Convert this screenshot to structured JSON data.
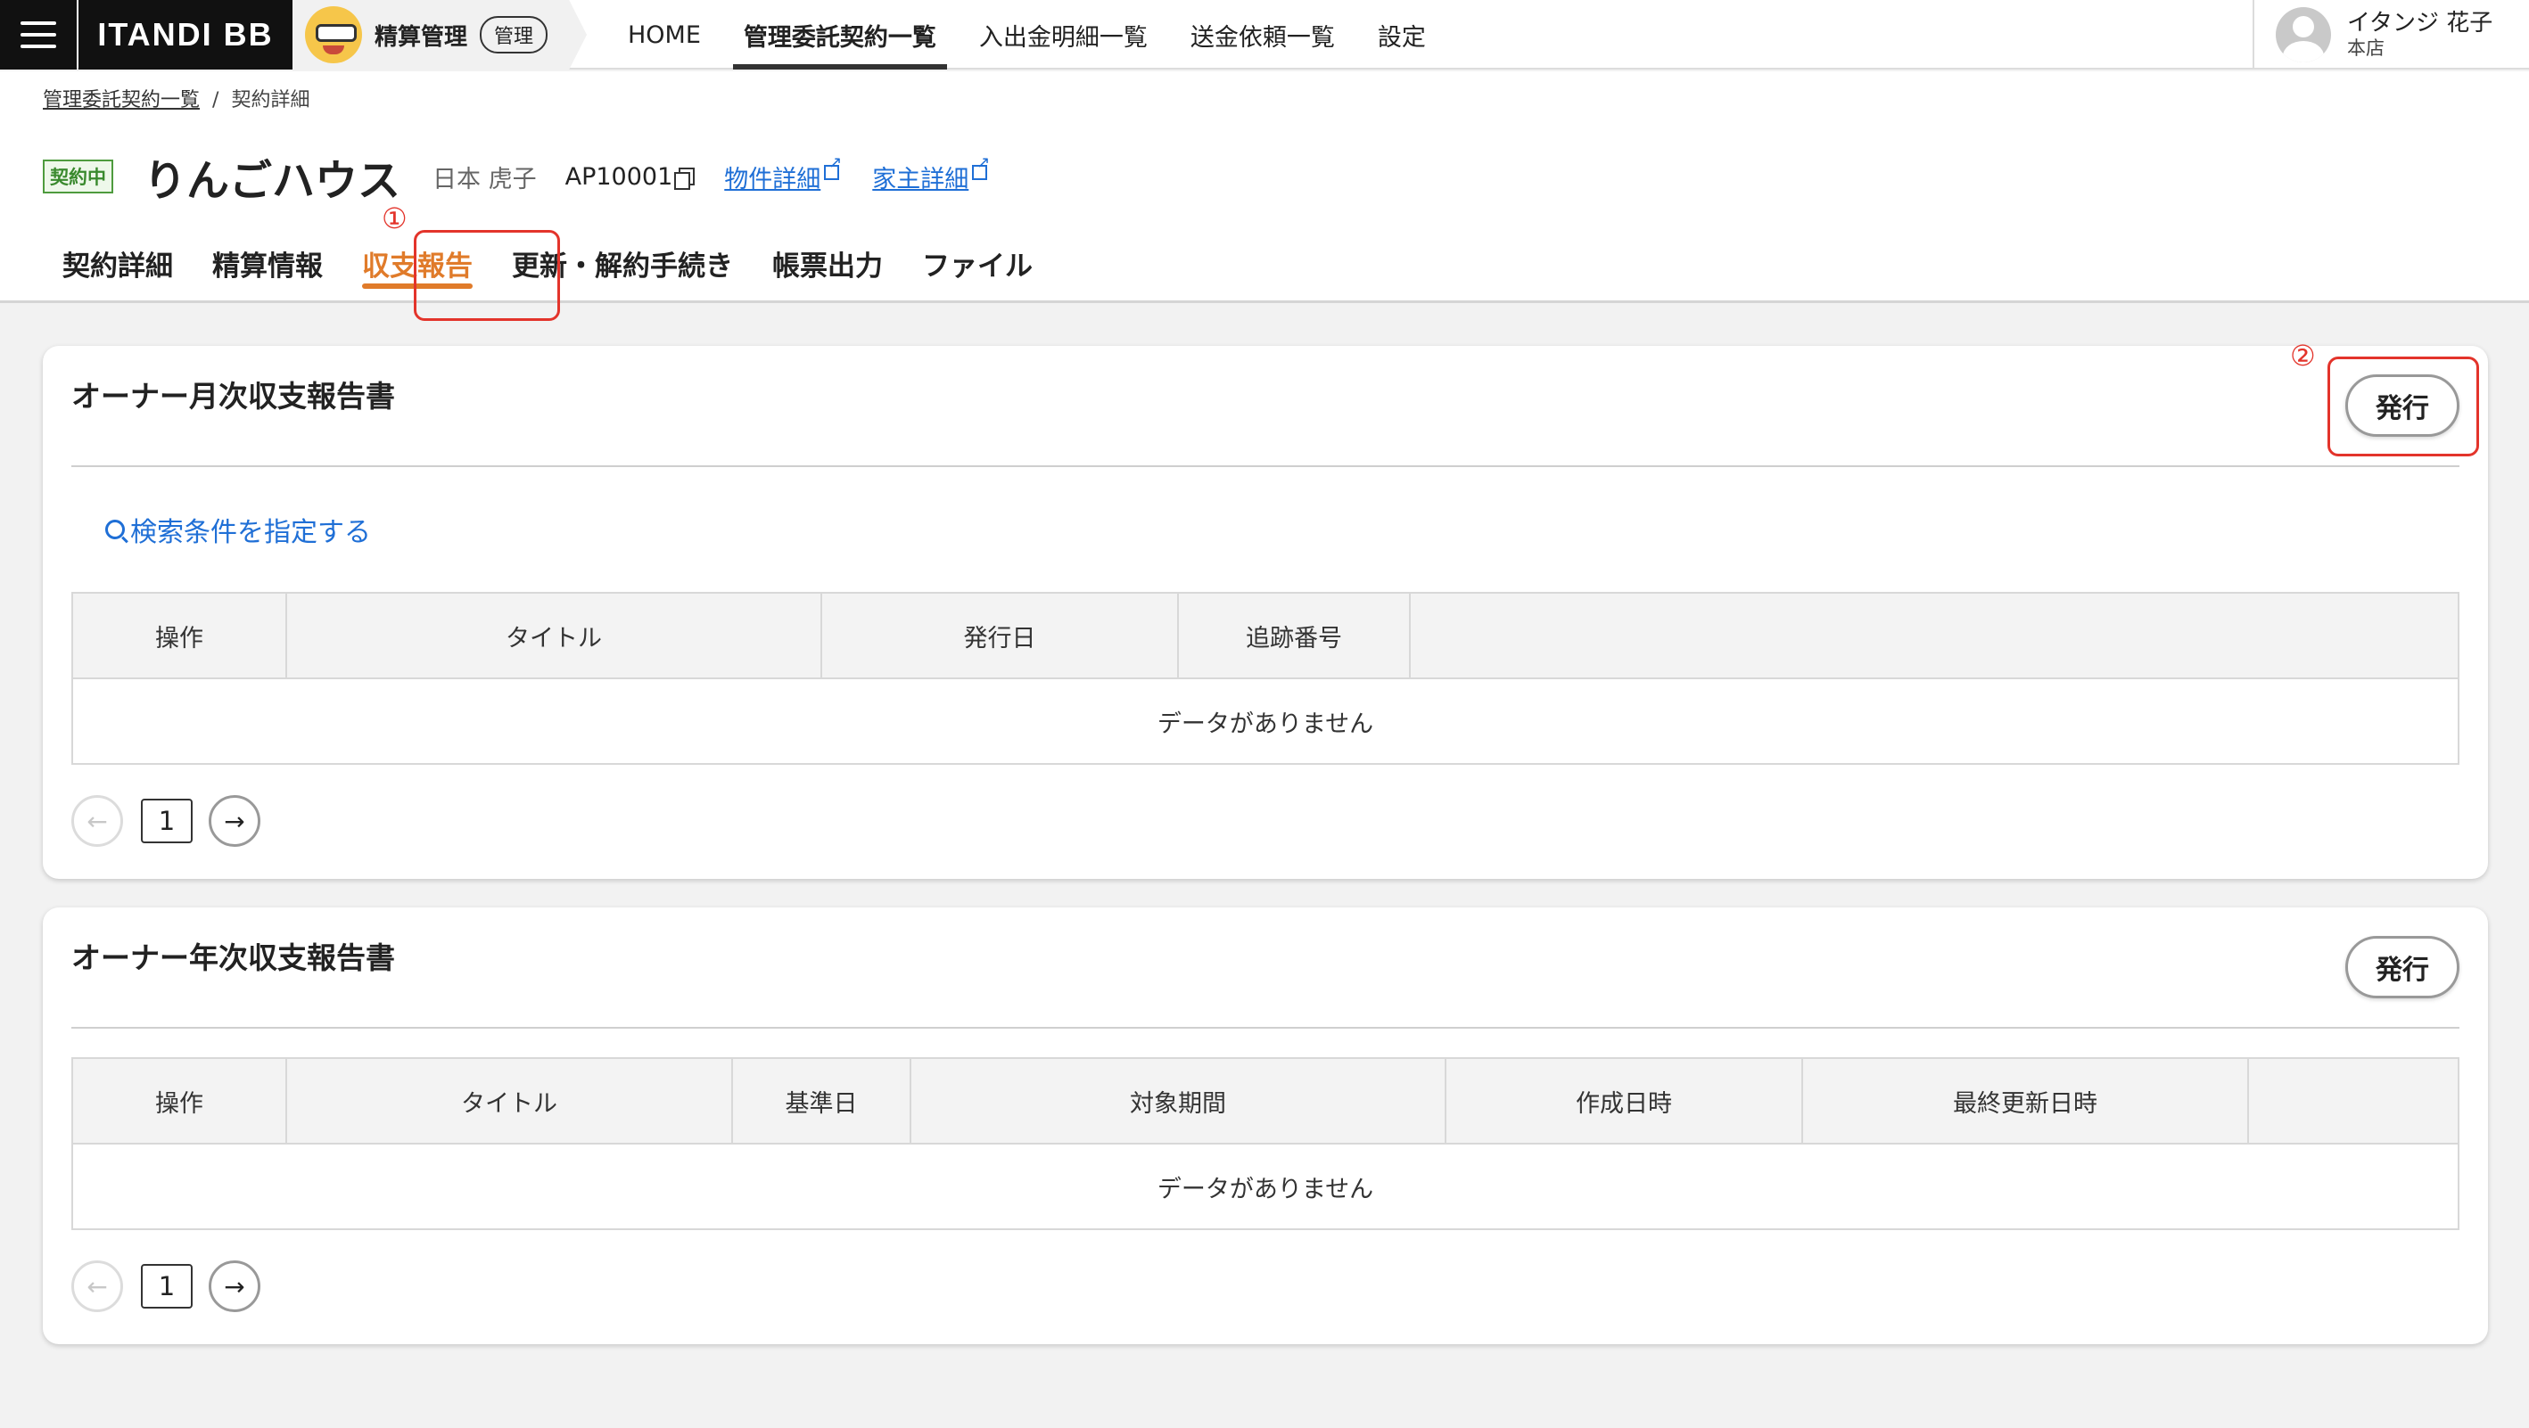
{
  "topbar": {
    "brand": "ITANDI BB",
    "app_name": "精算管理",
    "app_badge": "管理",
    "nav": [
      {
        "label": "HOME"
      },
      {
        "label": "管理委託契約一覧"
      },
      {
        "label": "入出金明細一覧"
      },
      {
        "label": "送金依頼一覧"
      },
      {
        "label": "設定"
      }
    ],
    "active_nav": "管理委託契約一覧",
    "user": {
      "name": "イタンジ 花子",
      "branch": "本店"
    }
  },
  "breadcrumb": {
    "parent": "管理委託契約一覧",
    "separator": "/",
    "current": "契約詳細"
  },
  "header": {
    "status": "契約中",
    "property_name": "りんごハウス",
    "owner_name": "日本 虎子",
    "contract_id": "AP10001",
    "property_link": "物件詳細",
    "landlord_link": "家主詳細"
  },
  "tabs": [
    {
      "label": "契約詳細"
    },
    {
      "label": "精算情報"
    },
    {
      "label": "収支報告"
    },
    {
      "label": "更新・解約手続き"
    },
    {
      "label": "帳票出力"
    },
    {
      "label": "ファイル"
    }
  ],
  "active_tab": "収支報告",
  "annotations": [
    "①",
    "②"
  ],
  "monthly": {
    "title": "オーナー月次収支報告書",
    "issue_label": "発行",
    "search_label": "検索条件を指定する",
    "columns": [
      "操作",
      "タイトル",
      "発行日",
      "追跡番号",
      ""
    ],
    "empty_text": "データがありません",
    "page": "1"
  },
  "yearly": {
    "title": "オーナー年次収支報告書",
    "issue_label": "発行",
    "columns": [
      "操作",
      "タイトル",
      "基準日",
      "対象期間",
      "作成日時",
      "最終更新日時",
      ""
    ],
    "empty_text": "データがありません",
    "page": "1"
  },
  "colors": {
    "accent": "#e07b2a",
    "link": "#1f6fd6",
    "annotation": "#e3342b",
    "status": "#3a8a2e"
  }
}
